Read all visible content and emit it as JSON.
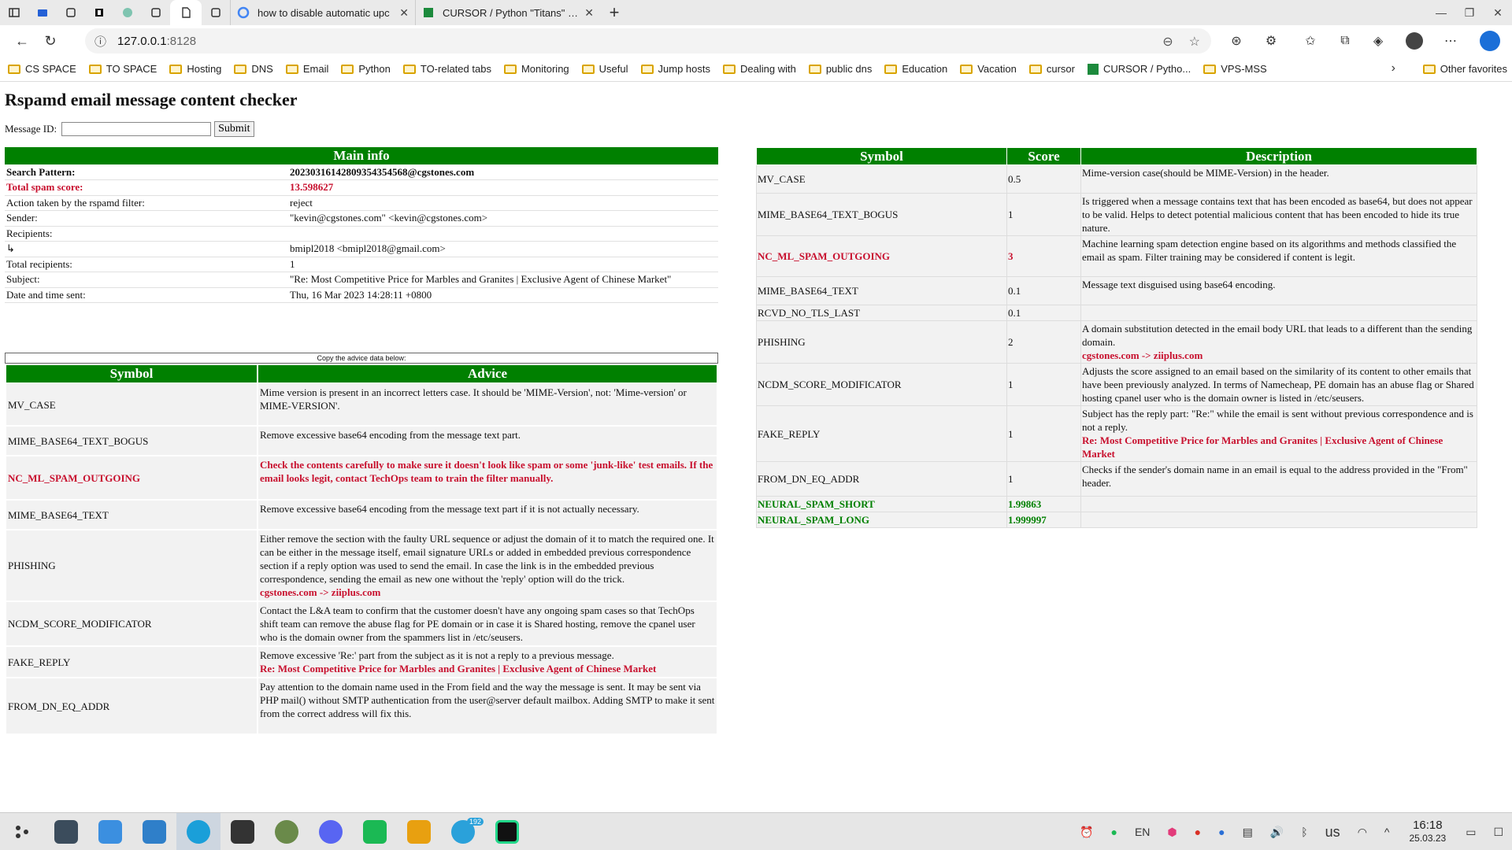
{
  "browser": {
    "tabs": [
      {
        "label": "how to disable automatic upc",
        "icon": "google-icon"
      },
      {
        "label": "CURSOR / Python \"Titans\" Gr",
        "icon": "cursor-icon"
      }
    ],
    "url_host": "127.0.0.1",
    "url_port": ":8128",
    "bookmarks": [
      "CS SPACE",
      "TO SPACE",
      "Hosting",
      "DNS",
      "Email",
      "Python",
      "TO-related tabs",
      "Monitoring",
      "Useful",
      "Jump hosts",
      "Dealing with",
      "public dns",
      "Education",
      "Vacation",
      "cursor",
      "CURSOR / Pytho...",
      "VPS-MSS"
    ],
    "other_favorites": "Other favorites"
  },
  "page": {
    "title": "Rspamd email message content checker",
    "form": {
      "label": "Message ID:",
      "value": "",
      "submit": "Submit"
    },
    "main_info": {
      "header": "Main info",
      "rows": [
        {
          "label": "Search Pattern:",
          "value": "20230316142809354354568@cgstones.com"
        },
        {
          "label": "Total spam score:",
          "value": "13.598627"
        },
        {
          "label": "Action taken by the rspamd filter:",
          "value": "reject"
        },
        {
          "label": "Sender:",
          "value": "\"kevin@cgstones.com\" <kevin@cgstones.com>"
        },
        {
          "label": "Recipients:",
          "value": ""
        },
        {
          "label": "↳",
          "value": "bmipl2018 <bmipl2018@gmail.com>"
        },
        {
          "label": "Total recipients:",
          "value": "1"
        },
        {
          "label": "Subject:",
          "value": "\"Re: Most Competitive Price for Marbles and Granites | Exclusive Agent of Chinese Market\""
        },
        {
          "label": "Date and time sent:",
          "value": "Thu, 16 Mar 2023 14:28:11 +0800"
        }
      ]
    },
    "copy_label": "Copy the advice data below:",
    "advice": {
      "headers": {
        "symbol": "Symbol",
        "advice": "Advice"
      },
      "rows": [
        {
          "symbol": "MV_CASE",
          "text": "Mime version is present in an incorrect letters case. It should be 'MIME-Version', not: 'Mime-version' or MIME-VERSION'.",
          "extra": ""
        },
        {
          "symbol": "MIME_BASE64_TEXT_BOGUS",
          "text": "Remove excessive base64 encoding from the message text part.",
          "extra": ""
        },
        {
          "symbol": "NC_ML_SPAM_OUTGOING",
          "text": "Check the contents carefully to make sure it doesn't look like spam or some 'junk-like' test emails. If the email looks legit, contact TechOps team to train the filter manually.",
          "extra": ""
        },
        {
          "symbol": "MIME_BASE64_TEXT",
          "text": "Remove excessive base64 encoding from the message text part if it is not actually necessary.",
          "extra": ""
        },
        {
          "symbol": "PHISHING",
          "text": "Either remove the section with the faulty URL sequence or adjust the domain of it to match the required one. It can be either in the message itself, email signature URLs or added in embedded previous correspondence section if a reply option was used to send the email. In case the link is in the embedded previous correspondence, sending the email as new one without the 'reply' option will do the trick.",
          "extra": "cgstones.com -> ziiplus.com"
        },
        {
          "symbol": "NCDM_SCORE_MODIFICATOR",
          "text": "Contact the L&A team to confirm that the customer doesn't have any ongoing spam cases so that TechOps shift team can remove the abuse flag for PE domain or in case it is Shared hosting, remove the cpanel user who is the domain owner from the spammers list in /etc/seusers.",
          "extra": ""
        },
        {
          "symbol": "FAKE_REPLY",
          "text": "Remove excessive 'Re:' part from the subject as it is not a reply to a previous message.",
          "extra": "Re: Most Competitive Price for Marbles and Granites | Exclusive Agent of Chinese Market"
        },
        {
          "symbol": "FROM_DN_EQ_ADDR",
          "text": "Pay attention to the domain name used in the From field and the way the message is sent. It may be sent via PHP mail() without SMTP authentication from the user@server default mailbox. Adding SMTP to make it sent from the correct address will fix this.",
          "extra": ""
        }
      ]
    },
    "symbols": {
      "headers": {
        "symbol": "Symbol",
        "score": "Score",
        "description": "Description"
      },
      "rows": [
        {
          "symbol": "MV_CASE",
          "score": "0.5",
          "desc": "Mime-version case(should be MIME-Version) in the header.",
          "extra": ""
        },
        {
          "symbol": "MIME_BASE64_TEXT_BOGUS",
          "score": "1",
          "desc": "Is triggered when a message contains text that has been encoded as base64, but does not appear to be valid. Helps to detect potential malicious content that has been encoded to hide its true nature.",
          "extra": ""
        },
        {
          "symbol": "NC_ML_SPAM_OUTGOING",
          "score": "3",
          "desc": "Machine learning spam detection engine based on its algorithms and methods classified the email as spam. Filter training may be considered if content is legit.",
          "extra": ""
        },
        {
          "symbol": "MIME_BASE64_TEXT",
          "score": "0.1",
          "desc": "Message text disguised using base64 encoding.",
          "extra": ""
        },
        {
          "symbol": "RCVD_NO_TLS_LAST",
          "score": "0.1",
          "desc": "",
          "extra": ""
        },
        {
          "symbol": "PHISHING",
          "score": "2",
          "desc": "A domain substitution detected in the email body URL that leads to a different than the sending domain.",
          "extra": "cgstones.com -> ziiplus.com"
        },
        {
          "symbol": "NCDM_SCORE_MODIFICATOR",
          "score": "1",
          "desc": "Adjusts the score assigned to an email based on the similarity of its content to other emails that have been previously analyzed. In terms of Namecheap, PE domain has an abuse flag or Shared hosting cpanel user who is the domain owner is listed in /etc/seusers.",
          "extra": ""
        },
        {
          "symbol": "FAKE_REPLY",
          "score": "1",
          "desc": "Subject has the reply part: \"Re:\" while the email is sent without previous correspondence and is not a reply.",
          "extra": "Re: Most Competitive Price for Marbles and Granites | Exclusive Agent of Chinese Market"
        },
        {
          "symbol": "FROM_DN_EQ_ADDR",
          "score": "1",
          "desc": "Checks if the sender's domain name in an email is equal to the address provided in the \"From\" header.",
          "extra": ""
        },
        {
          "symbol": "NEURAL_SPAM_SHORT",
          "score": "1.99863",
          "desc": "",
          "extra": ""
        },
        {
          "symbol": "NEURAL_SPAM_LONG",
          "score": "1.999997",
          "desc": "",
          "extra": ""
        }
      ]
    }
  },
  "taskbar": {
    "lang": "EN",
    "layout": "us",
    "time": "16:18",
    "date": "25.03.23",
    "telegram_badge": "192"
  },
  "colors": {
    "green": "#008000",
    "red": "#c8102e"
  }
}
